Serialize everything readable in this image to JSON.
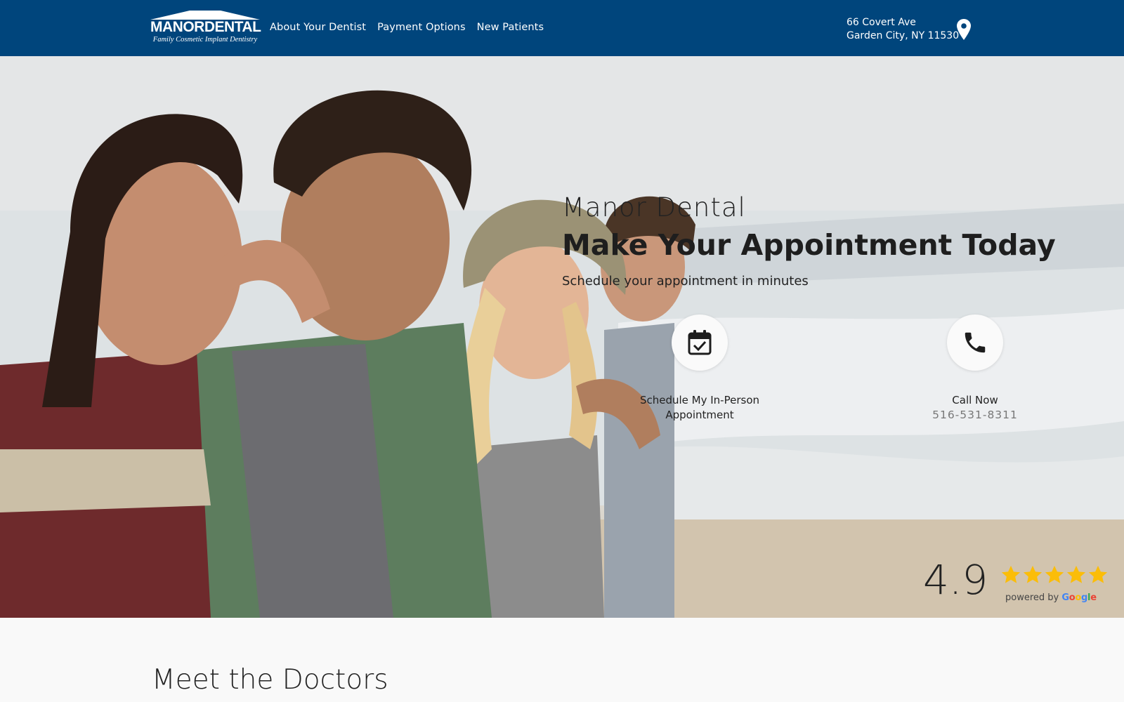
{
  "header": {
    "logo": {
      "main": "MANORDENTAL",
      "tagline": "Family Cosmetic Implant Dentistry"
    },
    "nav": [
      "About Your Dentist",
      "Payment Options",
      "New Patients"
    ],
    "address": {
      "line1": "66 Covert Ave",
      "line2": "Garden City, NY 11530"
    },
    "icon": "map-pin-icon"
  },
  "hero": {
    "brand": "Manor Dental",
    "title": "Make Your Appointment Today",
    "subtitle": "Schedule your appointment in minutes",
    "actions": {
      "schedule": {
        "label_line1": "Schedule My In-Person",
        "label_line2": "Appointment",
        "icon": "calendar-check-icon"
      },
      "call": {
        "label": "Call Now",
        "phone": "516-531-8311",
        "icon": "phone-icon"
      }
    },
    "rating": {
      "score": "4.9",
      "stars": 5,
      "powered_by": "powered by",
      "provider": "Google"
    }
  },
  "doctors": {
    "title": "Meet the Doctors"
  },
  "colors": {
    "header_bg": "#00457c",
    "star": "#fbbd08",
    "google_blue": "#4285f4",
    "google_red": "#ea4335",
    "google_yellow": "#fbbc05",
    "google_green": "#34a853"
  }
}
